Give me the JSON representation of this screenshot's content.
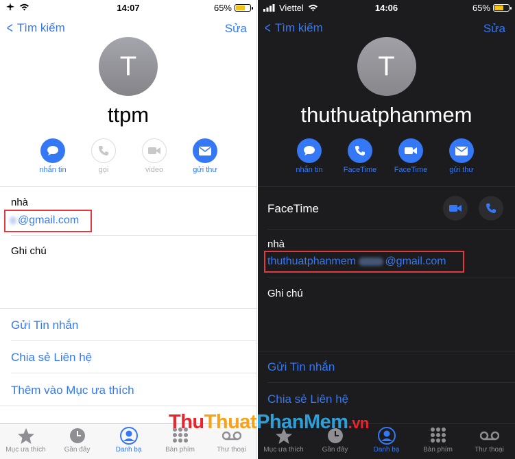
{
  "light": {
    "status": {
      "time": "14:07",
      "battery": "65%"
    },
    "nav": {
      "back": "Tìm kiếm",
      "edit": "Sửa"
    },
    "avatar_initial": "T",
    "name": "ttpm",
    "actions": [
      {
        "label": "nhắn tin",
        "icon": "message-icon"
      },
      {
        "label": "gọi",
        "icon": "phone-icon"
      },
      {
        "label": "video",
        "icon": "video-icon"
      },
      {
        "label": "gửi thư",
        "icon": "mail-icon"
      }
    ],
    "email_label": "nhà",
    "email_value": "@gmail.com",
    "notes_label": "Ghi chú",
    "links": [
      "Gửi Tin nhắn",
      "Chia sẻ Liên hệ",
      "Thêm vào Mục ưa thích"
    ],
    "tabs": [
      {
        "label": "Mục ưa thích",
        "icon": "star-icon"
      },
      {
        "label": "Gần đây",
        "icon": "clock-icon"
      },
      {
        "label": "Danh bạ",
        "icon": "contacts-icon"
      },
      {
        "label": "Bàn phím",
        "icon": "keypad-icon"
      },
      {
        "label": "Thư thoại",
        "icon": "voicemail-icon"
      }
    ]
  },
  "dark": {
    "status": {
      "carrier": "Viettel",
      "time": "14:06",
      "battery": "65%"
    },
    "nav": {
      "back": "Tìm kiếm",
      "edit": "Sửa"
    },
    "avatar_initial": "T",
    "name": "thuthuatphanmem",
    "actions": [
      {
        "label": "nhắn tin",
        "icon": "message-icon"
      },
      {
        "label": "FaceTime",
        "icon": "phone-icon"
      },
      {
        "label": "FaceTime",
        "icon": "video-icon"
      },
      {
        "label": "gửi thư",
        "icon": "mail-icon"
      }
    ],
    "facetime_label": "FaceTime",
    "email_label": "nhà",
    "email_prefix": "thuthuatphanmem",
    "email_suffix": "@gmail.com",
    "notes_label": "Ghi chú",
    "links": [
      "Gửi Tin nhắn",
      "Chia sẻ Liên hệ"
    ],
    "tabs": [
      {
        "label": "Mục ưa thích",
        "icon": "star-icon"
      },
      {
        "label": "Gần đây",
        "icon": "clock-icon"
      },
      {
        "label": "Danh bạ",
        "icon": "contacts-icon"
      },
      {
        "label": "Bàn phím",
        "icon": "keypad-icon"
      },
      {
        "label": "Thư thoại",
        "icon": "voicemail-icon"
      }
    ]
  },
  "watermark": {
    "part1": "Thu",
    "part2": "Thuat",
    "part3": "PhanMem",
    "part4": ".vn"
  },
  "colors": {
    "accent": "#3478f6",
    "highlight_box": "#e0393e",
    "battery": "#f0c21a"
  }
}
